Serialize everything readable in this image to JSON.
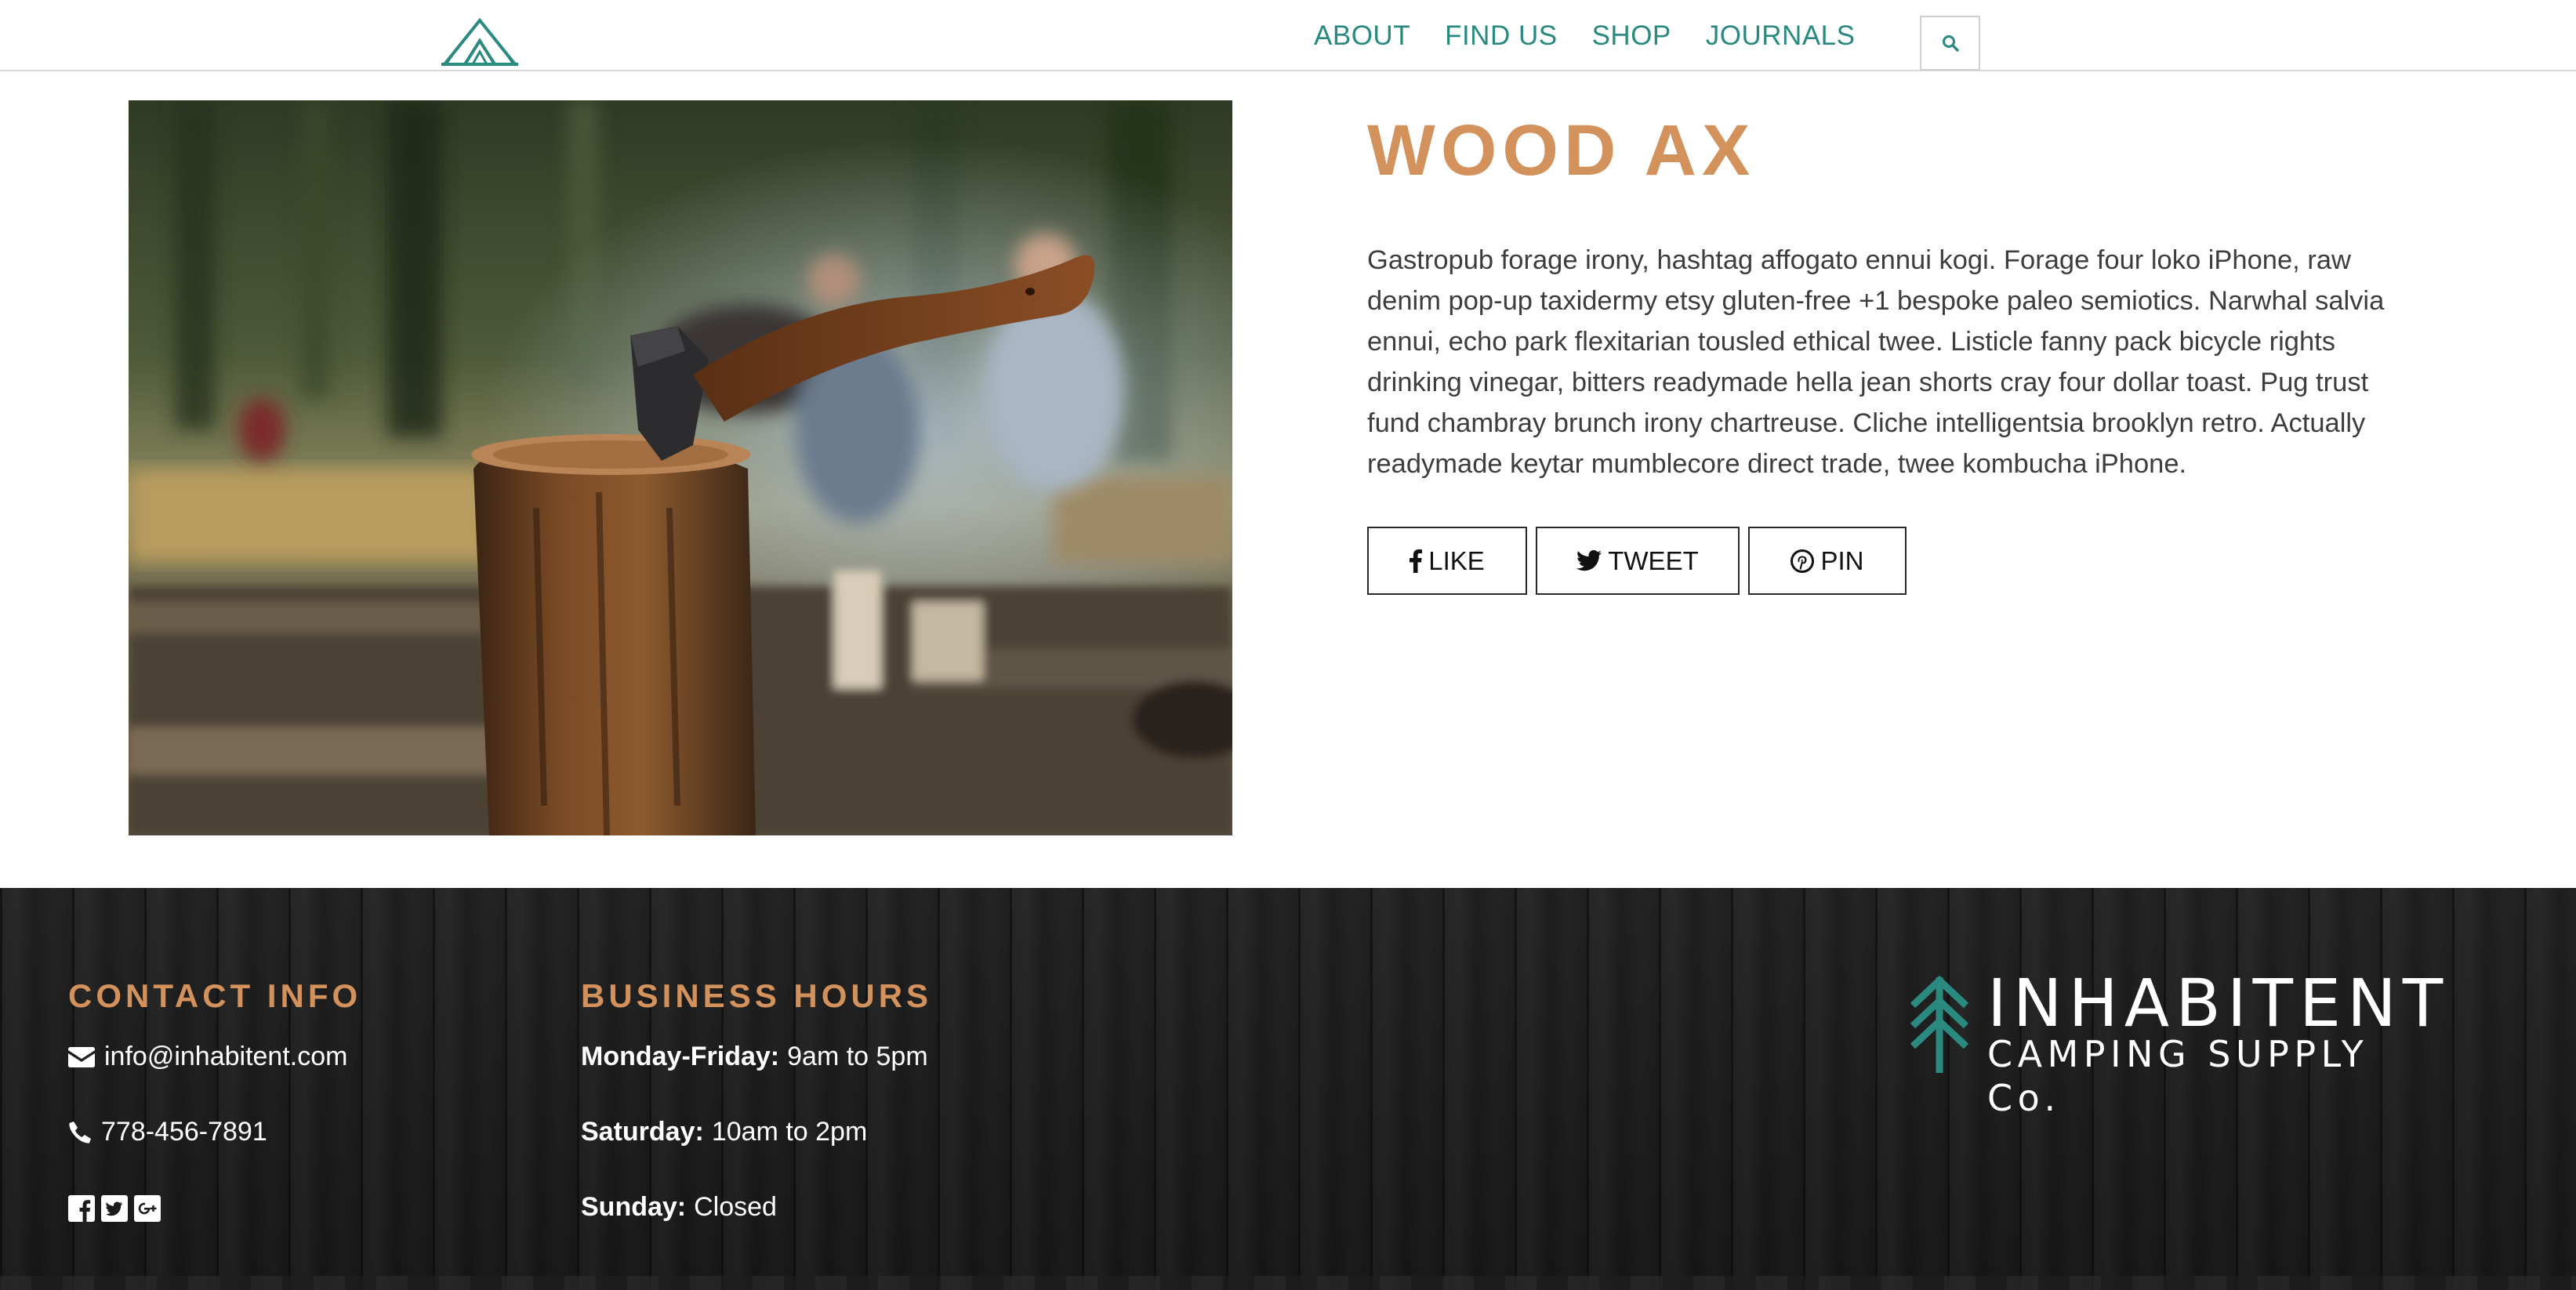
{
  "header": {
    "logo_icon": "tent-logo-icon",
    "nav": [
      {
        "label": "ABOUT"
      },
      {
        "label": "FIND US"
      },
      {
        "label": "SHOP"
      },
      {
        "label": "JOURNALS"
      }
    ],
    "search_icon": "search-icon",
    "accent_color": "#2b8a80"
  },
  "product": {
    "image_alt": "axe-in-stump-photo",
    "title": "WOOD AX",
    "title_color": "#d3915b",
    "description": "Gastropub forage irony, hashtag affogato ennui kogi. Forage four loko iPhone, raw denim pop-up taxidermy etsy gluten-free +1 bespoke paleo semiotics. Narwhal salvia ennui, echo park flexitarian tousled ethical twee. Listicle fanny pack bicycle rights drinking vinegar, bitters readymade hella jean shorts cray four dollar toast. Pug trust fund chambray brunch irony chartreuse. Cliche intelligentsia brooklyn retro. Actually readymade keytar mumblecore direct trade, twee kombucha iPhone.",
    "share": [
      {
        "label": "LIKE",
        "icon": "facebook-icon"
      },
      {
        "label": "TWEET",
        "icon": "twitter-icon"
      },
      {
        "label": "PIN",
        "icon": "pinterest-icon"
      }
    ]
  },
  "footer": {
    "contact": {
      "heading": "CONTACT INFO",
      "email": "info@inhabitent.com",
      "phone": "778-456-7891",
      "social_icons": [
        "facebook-square-icon",
        "twitter-square-icon",
        "google-plus-square-icon"
      ]
    },
    "hours": {
      "heading": "BUSINESS HOURS",
      "rows": [
        {
          "day": "Monday-Friday:",
          "time": "9am to 5pm"
        },
        {
          "day": "Saturday:",
          "time": "10am to 2pm"
        },
        {
          "day": "Sunday:",
          "time": "Closed"
        }
      ]
    },
    "brand": {
      "name": "INHABITENT",
      "tagline": "CAMPING SUPPLY Co.",
      "tree_color": "#2b8a80"
    }
  }
}
